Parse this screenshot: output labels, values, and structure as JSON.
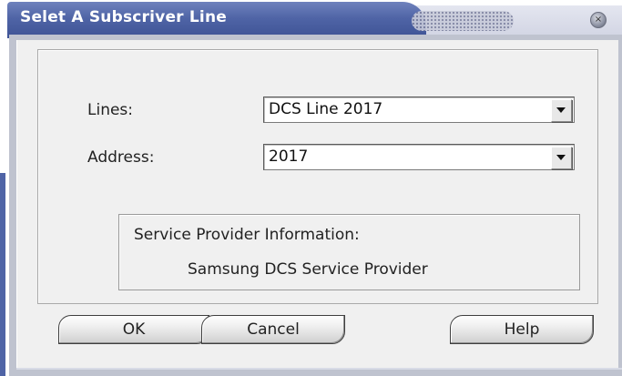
{
  "window": {
    "title": "Selet A Subscriver Line",
    "close_icon": "close-icon",
    "accent_color": "#4f64a6"
  },
  "form": {
    "lines_label": "Lines:",
    "lines_value": "DCS Line 2017",
    "address_label": "Address:",
    "address_value": "2017"
  },
  "provider": {
    "heading": "Service Provider Information:",
    "name": "Samsung DCS Service Provider"
  },
  "buttons": {
    "ok": "OK",
    "cancel": "Cancel",
    "help": "Help"
  }
}
